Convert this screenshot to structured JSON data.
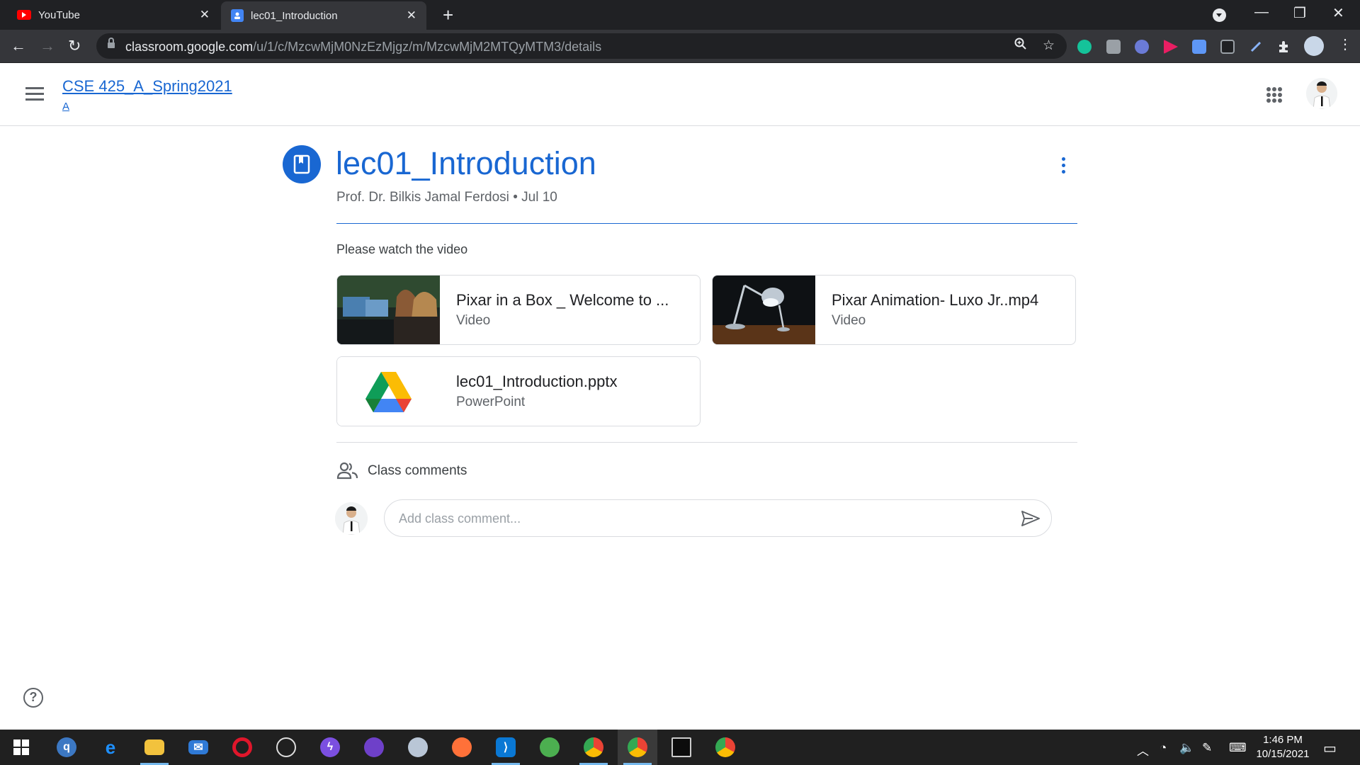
{
  "browser": {
    "tabs": [
      {
        "title": "YouTube",
        "active": false
      },
      {
        "title": "lec01_Introduction",
        "active": true
      }
    ],
    "url_host": "classroom.google.com",
    "url_path": "/u/1/c/MzcwMjM0NzEzMjgz/m/MzcwMjM2MTQyMTM3/details"
  },
  "header": {
    "class_name": "CSE 425_A_Spring2021",
    "section": "A"
  },
  "material": {
    "title": "lec01_Introduction",
    "author": "Prof. Dr. Bilkis Jamal Ferdosi",
    "date": "Jul 10",
    "separator": "•",
    "description": "Please watch the video",
    "attachments": [
      {
        "title": "Pixar in a Box _ Welcome to ...",
        "type": "Video"
      },
      {
        "title": "Pixar Animation- Luxo Jr..mp4",
        "type": "Video"
      },
      {
        "title": "lec01_Introduction.pptx",
        "type": "PowerPoint"
      }
    ]
  },
  "comments": {
    "label": "Class comments",
    "placeholder": "Add class comment..."
  },
  "taskbar": {
    "time": "1:46 PM",
    "date": "10/15/2021"
  },
  "colors": {
    "accent": "#1967d2",
    "chrome_dark": "#202124",
    "chrome_toolbar": "#35363a",
    "taskbar": "#202020"
  }
}
